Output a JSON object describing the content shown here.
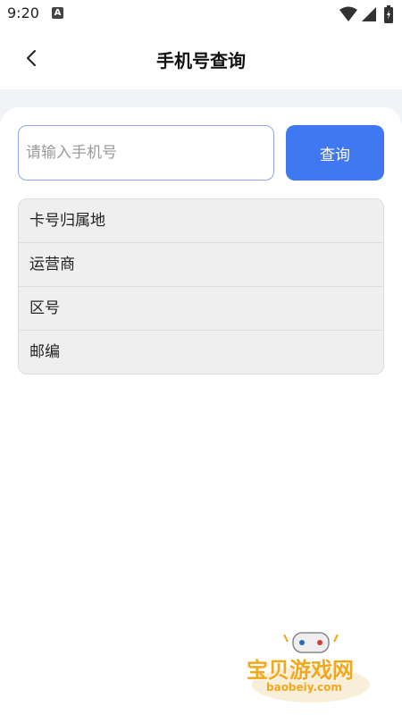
{
  "status_bar": {
    "time": "9:20",
    "notification_icon_letter": "A",
    "icons": [
      "wifi-icon",
      "signal-icon",
      "battery-icon"
    ]
  },
  "header": {
    "title": "手机号查询",
    "back_icon": "chevron-left-icon"
  },
  "search": {
    "placeholder": "请输入手机号",
    "value": "",
    "button_label": "查询"
  },
  "results": {
    "rows": [
      {
        "label": "卡号归属地"
      },
      {
        "label": "运营商"
      },
      {
        "label": "区号"
      },
      {
        "label": "邮编"
      }
    ]
  },
  "watermark": {
    "title": "宝贝游戏网",
    "url": "baobeiy.com"
  },
  "colors": {
    "accent": "#3f78f0",
    "input_border": "#8ea6ee",
    "list_bg": "#efefef",
    "page_bg": "#f2f3f6",
    "watermark": "#f2a81c"
  }
}
